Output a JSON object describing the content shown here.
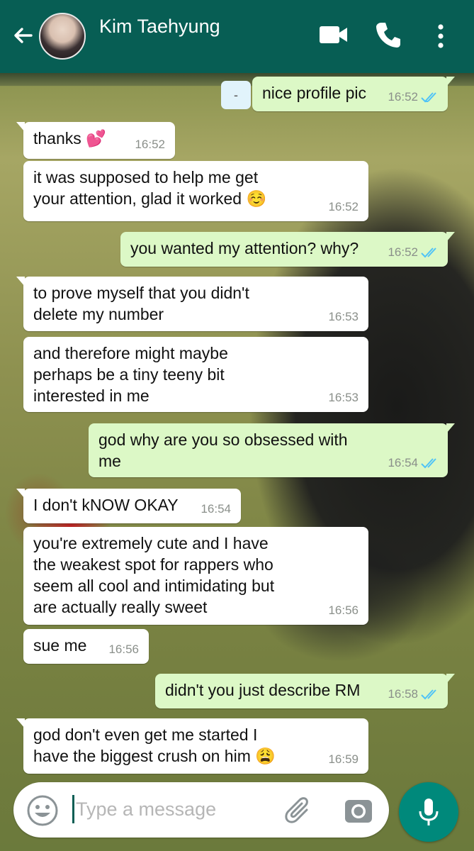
{
  "header": {
    "contact_name": "Kim Taehyung",
    "icons": [
      "back-arrow-icon",
      "video-call-icon",
      "phone-icon",
      "more-options-icon"
    ]
  },
  "date_chip": "-",
  "messages": [
    {
      "dir": "out",
      "text": "nice profile pic",
      "time": "16:52"
    },
    {
      "dir": "in",
      "text": "thanks 💕",
      "time": "16:52"
    },
    {
      "dir": "in",
      "text": "it was supposed to help me get\nyour attention, glad it worked ☺️",
      "time": "16:52"
    },
    {
      "dir": "out",
      "text": "you wanted my attention? why?",
      "time": "16:52"
    },
    {
      "dir": "in",
      "text": "to prove myself that you didn't\ndelete my number",
      "time": "16:53"
    },
    {
      "dir": "in",
      "text": "and therefore might maybe\nperhaps be a tiny teeny bit\ninterested in me",
      "time": "16:53"
    },
    {
      "dir": "out",
      "text": "god why are you so obsessed with\nme",
      "time": "16:54"
    },
    {
      "dir": "in",
      "text": "I don't kNOW OKAY",
      "time": "16:54"
    },
    {
      "dir": "in",
      "text": "you're extremely cute and I have\nthe weakest spot for rappers who\nseem all cool and intimidating but\nare actually really sweet",
      "time": "16:56"
    },
    {
      "dir": "in",
      "text": "sue me",
      "time": "16:56"
    },
    {
      "dir": "out",
      "text": "didn't you just describe RM",
      "time": "16:58"
    },
    {
      "dir": "in",
      "text": "god don't even get me started I\nhave the biggest crush on him 😩",
      "time": "16:59"
    }
  ],
  "composer": {
    "placeholder": "Type a message"
  },
  "colors": {
    "header": "#075e54",
    "outgoing_bubble": "#dcf8c6",
    "incoming_bubble": "#ffffff",
    "read_ticks": "#4fc3f7",
    "mic_button": "#00897b"
  }
}
